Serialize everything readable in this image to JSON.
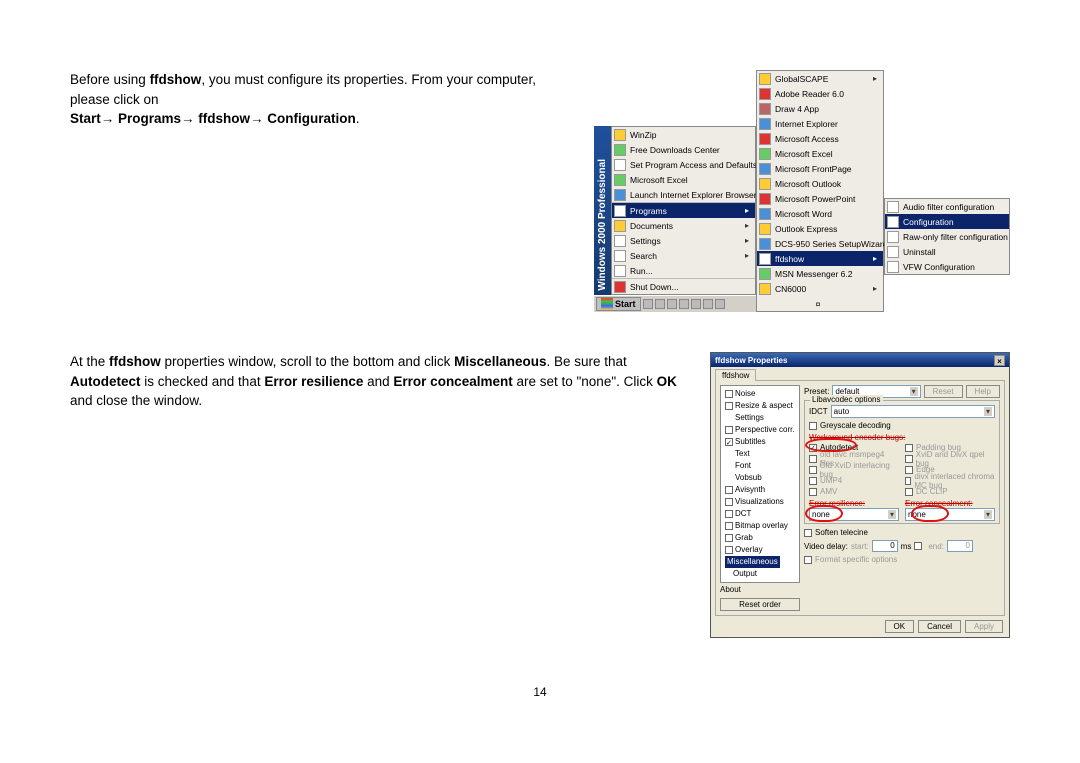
{
  "page_number": "14",
  "para1": {
    "pre": "Before using ",
    "bold1": "ffdshow",
    "mid": ", you must configure its properties. From your computer, please click on ",
    "path1": "Start",
    "path2": " Programs",
    "path3": " ffdshow",
    "path4": " Configuration",
    "end": "."
  },
  "para2": {
    "pre": "At the ",
    "bold1": "ffdshow",
    "mid1": " properties window, scroll to the bottom and click ",
    "bold2": "Miscellaneous",
    "mid2": ". Be sure that ",
    "bold3": "Autodetect",
    "mid3": " is checked and that ",
    "bold4": "Error resilience",
    "mid4": " and ",
    "bold5": "Error concealment",
    "mid5": " are set to \"none\". Click ",
    "bold6": "OK",
    "end": " and close the window."
  },
  "startmenu": {
    "sidebar": "Windows 2000 Professional",
    "main": [
      "WinZip",
      "Free Downloads Center",
      "Set Program Access and Defaults",
      "Microsoft Excel",
      "Launch Internet Explorer Browser",
      "Programs",
      "Documents",
      "Settings",
      "Search",
      "Run...",
      "Shut Down..."
    ],
    "progs": [
      "GlobalSCAPE",
      "Adobe Reader 6.0",
      "Draw 4 App",
      "Internet Explorer",
      "Microsoft Access",
      "Microsoft Excel",
      "Microsoft FrontPage",
      "Microsoft Outlook",
      "Microsoft PowerPoint",
      "Microsoft Word",
      "Outlook Express",
      "DCS-950 Series SetupWizard",
      "ffdshow",
      "MSN Messenger 6.2",
      "CN6000"
    ],
    "ff": [
      "Audio filter configuration",
      "Configuration",
      "Raw-only filter configuration",
      "Uninstall",
      "VFW Configuration"
    ],
    "start_label": "Start",
    "expand": "¤"
  },
  "dlg": {
    "title": "ffdshow Properties",
    "tab": "ffdshow",
    "tree": [
      "Noise",
      "Resize & aspect",
      "Settings",
      "Perspective corr.",
      "Subtitles",
      "Text",
      "Font",
      "Vobsub",
      "Avisynth",
      "Visualizations",
      "DCT",
      "Bitmap overlay",
      "Grab",
      "Overlay",
      "Miscellaneous",
      "Output"
    ],
    "about": "About",
    "reset_order": "Reset order",
    "preset_lbl": "Preset:",
    "preset_val": "default",
    "reset": "Reset",
    "help": "Help",
    "opts_title": "Libavcodec options",
    "idct_lbl": "IDCT",
    "idct_val": "auto",
    "grey": "Greyscale decoding",
    "workaround": "Workaround encoder bugs:",
    "autodetect": "Autodetect",
    "old_msmpeg": "old lavc msmpeg4 files",
    "xvid_interlace": "Old XviD interlacing bug",
    "ump4": "UMP4",
    "amv": "AMV",
    "padding": "Padding bug",
    "xvid_divx": "XviD and DivX qpel bug",
    "edge": "Edge",
    "divx_chroma": "divx interlaced chroma MC bug",
    "dc_clip": "DC CLIP",
    "err_res_lbl": "Error resilience:",
    "err_con_lbl": "Error concealment:",
    "none": "none",
    "softtc": "Soften telecine",
    "vdelay": "Video delay:",
    "start": "start:",
    "ms": "ms",
    "end": "end:",
    "zero": "0",
    "fmt": "Format specific options",
    "ok": "OK",
    "cancel": "Cancel",
    "apply": "Apply"
  }
}
